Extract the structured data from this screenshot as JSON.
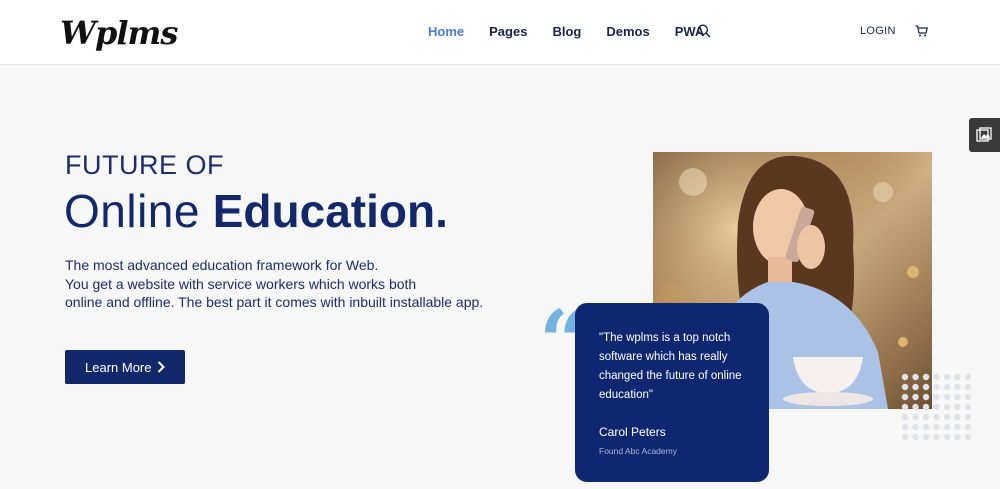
{
  "header": {
    "logo": "Wplms",
    "nav": [
      "Home",
      "Pages",
      "Blog",
      "Demos",
      "PWA"
    ],
    "login": "LOGIN"
  },
  "hero": {
    "kicker": "FUTURE OF",
    "title_light": "Online",
    "title_bold": "Education.",
    "description": [
      "The most advanced education framework for Web.",
      "You get a website with service workers which works both",
      "online and offline. The best part it comes with inbuilt installable app."
    ],
    "button": "Learn More"
  },
  "testimonial": {
    "quote": "\"The wplms is a top notch software which has really changed the future of online education\"",
    "name": "Carol Peters",
    "role": "Found Abc Academy"
  },
  "colors": {
    "primary": "#13286b",
    "accent": "#4a7bd1",
    "quote_mark": "#74b3e0"
  },
  "icons": {
    "search": "search-icon",
    "cart": "cart-icon",
    "side_tab": "gallery-icon",
    "button_arrow": "chevron-right-icon"
  }
}
